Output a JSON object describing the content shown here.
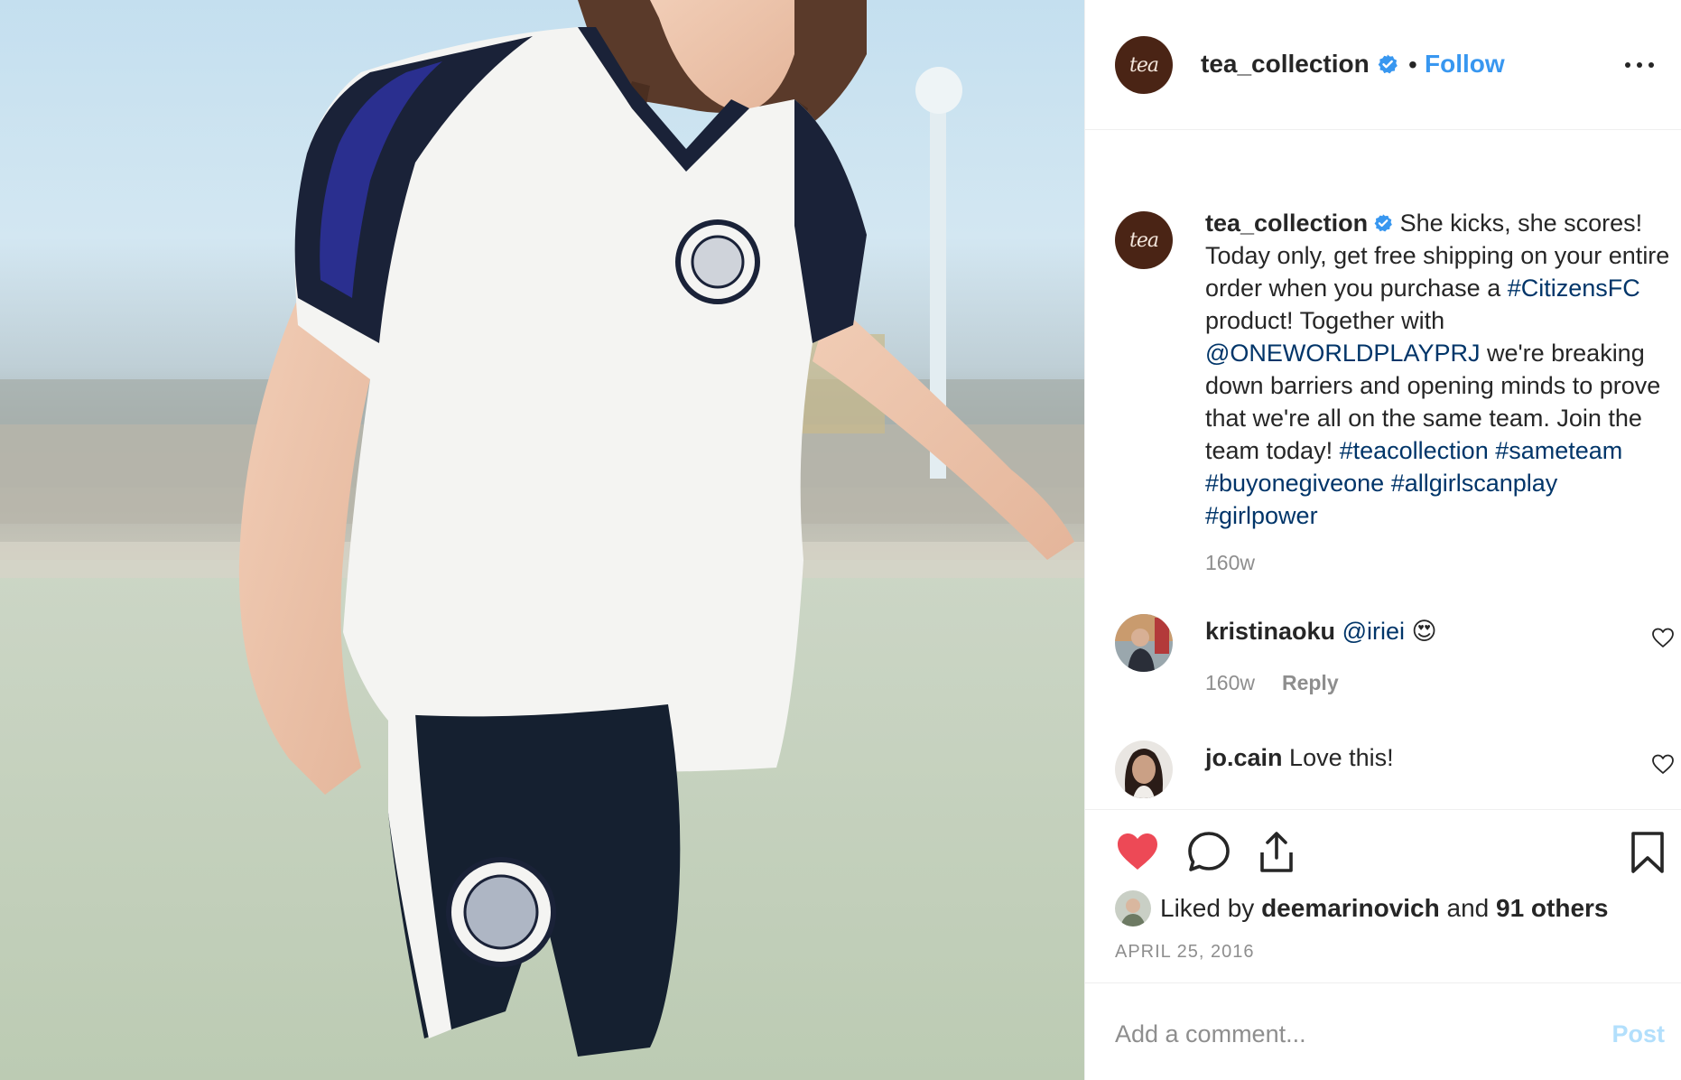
{
  "header": {
    "avatar_text": "tea",
    "username": "tea_collection",
    "verified": true,
    "dot": "•",
    "follow_label": "Follow"
  },
  "caption": {
    "avatar_text": "tea",
    "username": "tea_collection",
    "segments": [
      {
        "text": " She kicks, she scores! Today only, get free shipping on your entire order when you purchase a ",
        "kind": "text"
      },
      {
        "text": "#CitizensFC",
        "kind": "tag"
      },
      {
        "text": " product! Together with ",
        "kind": "text"
      },
      {
        "text": "@ONEWORLDPLAYPRJ",
        "kind": "tag"
      },
      {
        "text": " we're breaking down barriers and opening minds to prove that we're all on the same team. Join the team today! ",
        "kind": "text"
      },
      {
        "text": "#teacollection",
        "kind": "tag"
      },
      {
        "text": " ",
        "kind": "text"
      },
      {
        "text": "#sameteam",
        "kind": "tag"
      },
      {
        "text": " ",
        "kind": "text"
      },
      {
        "text": "#buyonegiveone",
        "kind": "tag"
      },
      {
        "text": " ",
        "kind": "text"
      },
      {
        "text": "#allgirlscanplay",
        "kind": "tag"
      },
      {
        "text": " ",
        "kind": "text"
      },
      {
        "text": "#girlpower",
        "kind": "tag"
      }
    ],
    "time": "160w"
  },
  "comments": [
    {
      "username": "kristinaoku",
      "mention": "@iriei",
      "emoji": "😍",
      "time": "160w",
      "reply_label": "Reply"
    },
    {
      "username": "jo.cain",
      "text": "Love this!"
    }
  ],
  "likes": {
    "prefix": "Liked by",
    "liker": "deemarinovich",
    "joiner": "and",
    "others": "91 others"
  },
  "date": "APRIL 25, 2016",
  "add_comment": {
    "placeholder": "Add a comment...",
    "post_label": "Post"
  },
  "colors": {
    "link_blue": "#3897f0",
    "hashtag": "#003569",
    "like_red": "#ed4956",
    "post_disabled": "#b2dffc",
    "tea_brown": "#4a2415"
  },
  "icons": {
    "verified": "verified-badge-icon",
    "more": "more-options-icon",
    "comment_like": "heart-outline-icon",
    "like": "heart-filled-icon",
    "comment": "comment-bubble-icon",
    "share": "share-icon",
    "save": "bookmark-icon"
  }
}
